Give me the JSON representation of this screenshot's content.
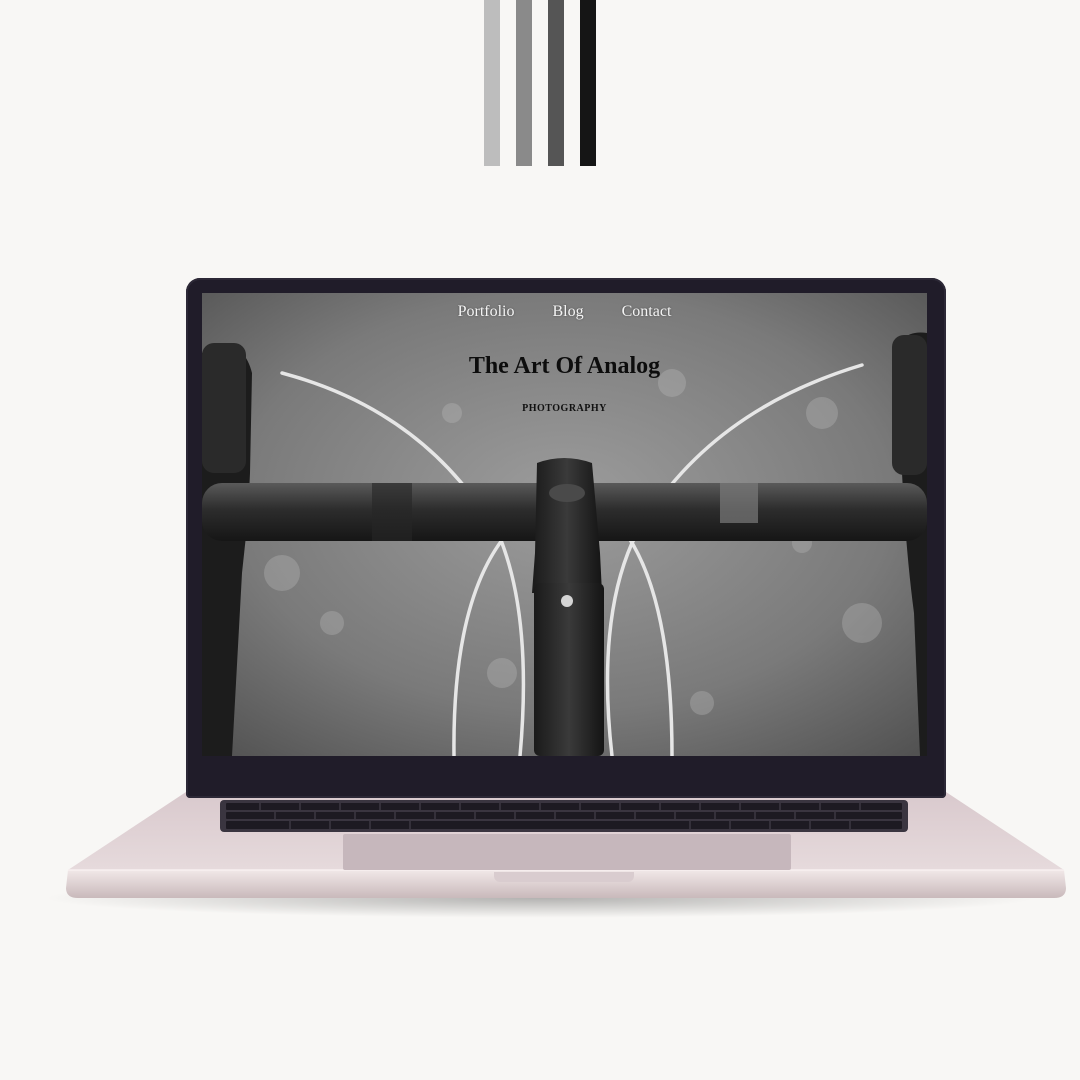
{
  "site": {
    "nav": [
      {
        "label": "Portfolio"
      },
      {
        "label": "Blog"
      },
      {
        "label": "Contact"
      }
    ],
    "title": "The Art Of Analog",
    "subtitle": "PHOTOGRAPHY"
  },
  "colors": {
    "background": "#f8f7f5",
    "laptop_bezel": "#201c29",
    "laptop_body": "#e8dcdd",
    "stripes": [
      "#bdbdbd",
      "#8a8a8a",
      "#555555",
      "#151515"
    ]
  },
  "icons": {
    "hero_image": "bicycle-handlebar-photo"
  }
}
